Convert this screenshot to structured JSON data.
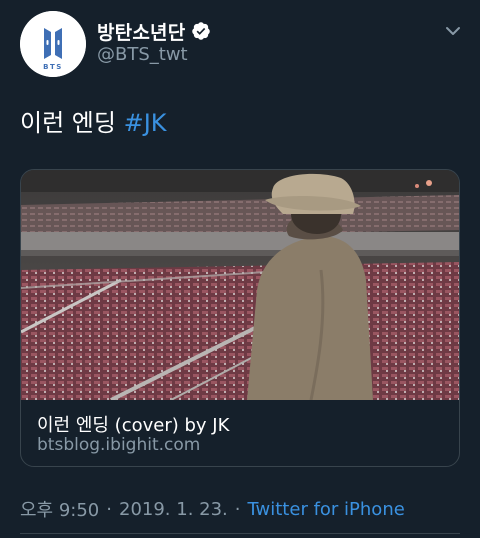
{
  "author": {
    "display_name": "방탄소년단",
    "handle": "@BTS_twt",
    "verified": true,
    "avatar_logo_text": "BTS"
  },
  "tweet": {
    "text": "이런 엔딩 ",
    "hashtag": "#JK"
  },
  "card": {
    "title": "이런 엔딩 (cover) by JK",
    "domain": "btsblog.ibighit.com",
    "image_icon": "stadium-photo"
  },
  "meta": {
    "time": "오후 9:50",
    "date": "2019. 1. 23.",
    "separator": "·",
    "source": "Twitter for iPhone"
  },
  "icons": {
    "more": "chevron-down-icon",
    "verified": "verified-badge-icon"
  },
  "colors": {
    "background": "#15202b",
    "accent": "#3a91e0",
    "secondary_text": "#8899a6",
    "border": "#38444d"
  }
}
